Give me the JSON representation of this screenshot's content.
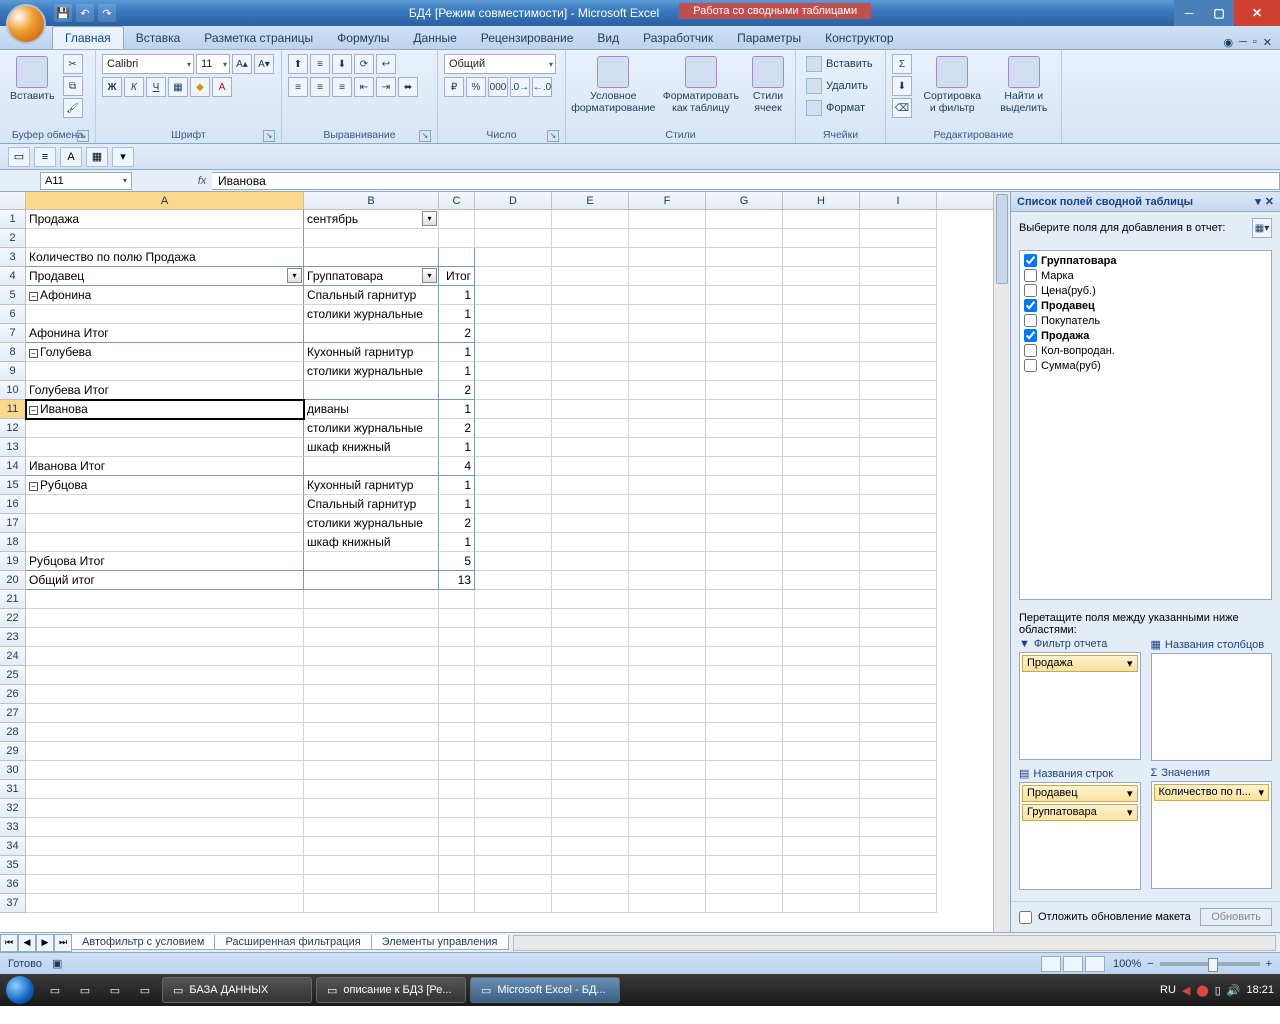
{
  "title": {
    "doc": "БД4  [Режим совместимости] - Microsoft Excel",
    "pivot_context": "Работа со сводными таблицами"
  },
  "ribbon_tabs": [
    "Главная",
    "Вставка",
    "Разметка страницы",
    "Формулы",
    "Данные",
    "Рецензирование",
    "Вид",
    "Разработчик",
    "Параметры",
    "Конструктор"
  ],
  "ribbon": {
    "clipboard": {
      "paste": "Вставить",
      "label": "Буфер обмена"
    },
    "font": {
      "name": "Calibri",
      "size": "11",
      "label": "Шрифт"
    },
    "alignment": {
      "label": "Выравнивание"
    },
    "number": {
      "format": "Общий",
      "label": "Число"
    },
    "styles": {
      "cond": "Условное\nформатирование",
      "table": "Форматировать\nкак таблицу",
      "cell": "Стили\nячеек",
      "label": "Стили"
    },
    "cells": {
      "insert": "Вставить",
      "delete": "Удалить",
      "format": "Формат",
      "label": "Ячейки"
    },
    "editing": {
      "sort": "Сортировка\nи фильтр",
      "find": "Найти и\nвыделить",
      "label": "Редактирование"
    }
  },
  "namebox": "A11",
  "formula": "Иванова",
  "columns": [
    "A",
    "B",
    "C",
    "D",
    "E",
    "F",
    "G",
    "H",
    "I"
  ],
  "rows": [
    {
      "n": 1,
      "a": "Продажа",
      "b": "сентябрь",
      "b_drop": true
    },
    {
      "n": 2
    },
    {
      "n": 3,
      "a": "Количество по полю Продажа",
      "bd": true
    },
    {
      "n": 4,
      "a": "Продавец",
      "a_drop": true,
      "b": "Группатовара",
      "b_drop": true,
      "c": "Итог",
      "bd": true
    },
    {
      "n": 5,
      "a": "Афонина",
      "collapse": true,
      "b": "Спальный гарнитур",
      "c": "1"
    },
    {
      "n": 6,
      "b": "столики журнальные",
      "c": "1"
    },
    {
      "n": 7,
      "a": "Афонина Итог",
      "c": "2",
      "bd": true
    },
    {
      "n": 8,
      "a": "Голубева",
      "collapse": true,
      "b": "Кухонный гарнитур",
      "c": "1"
    },
    {
      "n": 9,
      "b": "столики журнальные",
      "c": "1"
    },
    {
      "n": 10,
      "a": "Голубева Итог",
      "c": "2",
      "bd": true
    },
    {
      "n": 11,
      "a": "Иванова",
      "collapse": true,
      "b": "диваны",
      "c": "1",
      "active": true
    },
    {
      "n": 12,
      "b": "столики журнальные",
      "c": "2"
    },
    {
      "n": 13,
      "b": "шкаф книжный",
      "c": "1"
    },
    {
      "n": 14,
      "a": "Иванова Итог",
      "c": "4",
      "bd": true
    },
    {
      "n": 15,
      "a": "Рубцова",
      "collapse": true,
      "b": "Кухонный гарнитур",
      "c": "1"
    },
    {
      "n": 16,
      "b": "Спальный гарнитур",
      "c": "1"
    },
    {
      "n": 17,
      "b": "столики журнальные",
      "c": "2"
    },
    {
      "n": 18,
      "b": "шкаф книжный",
      "c": "1"
    },
    {
      "n": 19,
      "a": "Рубцова Итог",
      "c": "5",
      "bd": true
    },
    {
      "n": 20,
      "a": "Общий итог",
      "c": "13",
      "bd": true
    },
    {
      "n": 21
    },
    {
      "n": 22
    },
    {
      "n": 23
    },
    {
      "n": 24
    },
    {
      "n": 25
    },
    {
      "n": 26
    },
    {
      "n": 27
    },
    {
      "n": 28
    },
    {
      "n": 29
    },
    {
      "n": 30
    },
    {
      "n": 31
    },
    {
      "n": 32
    },
    {
      "n": 33
    },
    {
      "n": 34
    },
    {
      "n": 35
    },
    {
      "n": 36
    },
    {
      "n": 37
    }
  ],
  "pane": {
    "title": "Список полей сводной таблицы",
    "prompt": "Выберите поля для добавления в отчет:",
    "fields": [
      {
        "label": "Группатовара",
        "checked": true,
        "bold": true
      },
      {
        "label": "Марка",
        "checked": false
      },
      {
        "label": "Цена(руб.)",
        "checked": false
      },
      {
        "label": "Продавец",
        "checked": true,
        "bold": true
      },
      {
        "label": "Покупатель",
        "checked": false
      },
      {
        "label": "Продажа",
        "checked": true,
        "bold": true
      },
      {
        "label": "Кол-вопродан.",
        "checked": false
      },
      {
        "label": "Сумма(руб)",
        "checked": false
      }
    ],
    "drag_hint": "Перетащите поля между указанными ниже областями:",
    "area_filter": "Фильтр отчета",
    "area_cols": "Названия столбцов",
    "area_rows": "Названия строк",
    "area_vals": "Значения",
    "filter_pills": [
      "Продажа"
    ],
    "row_pills": [
      "Продавец",
      "Группатовара"
    ],
    "val_pills": [
      "Количество по п..."
    ],
    "defer": "Отложить обновление макета",
    "update": "Обновить"
  },
  "sheet_tabs": [
    "Автофильтр с условием",
    "Расширенная фильтрация",
    "Элементы управления"
  ],
  "status": {
    "ready": "Готово",
    "zoom": "100%"
  },
  "taskbar": {
    "tasks": [
      {
        "label": "БАЗА ДАННЫХ"
      },
      {
        "label": "описание к БД3 [Ре..."
      },
      {
        "label": "Microsoft Excel - БД...",
        "active": true
      }
    ],
    "lang": "RU",
    "time": "18:21"
  }
}
